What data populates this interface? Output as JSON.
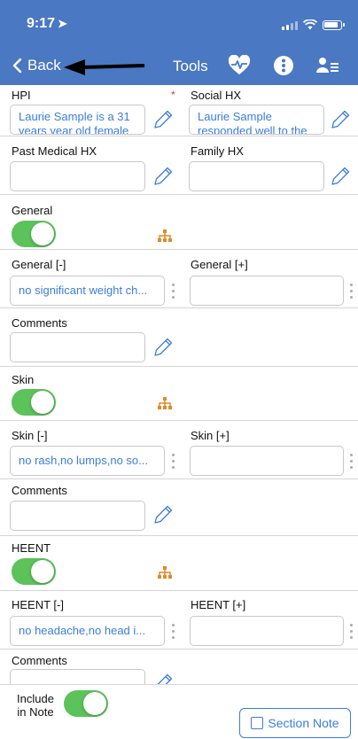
{
  "status": {
    "time": "9:17"
  },
  "nav": {
    "back_label": "Back",
    "tools_label": "Tools"
  },
  "colors": {
    "header": "#4a78c2",
    "accent": "#3b7ddd",
    "toggle_on": "#5cc25a",
    "tree_icon": "#e08a2a",
    "required": "#e0332e"
  },
  "history": {
    "hpi": {
      "label": "HPI",
      "required_mark": "*",
      "value": "Laurie Sample is a 31 years year old female"
    },
    "social": {
      "label": "Social HX",
      "value": "Laurie Sample responded well to the"
    },
    "past_medical": {
      "label": "Past Medical HX",
      "value": ""
    },
    "family": {
      "label": "Family HX",
      "value": ""
    }
  },
  "general": {
    "title": "General",
    "toggle_on": true,
    "neg_label": "General [-]",
    "neg_value": "no significant weight ch...",
    "pos_label": "General [+]",
    "pos_value": "",
    "comments_label": "Comments",
    "comments_value": ""
  },
  "skin": {
    "title": "Skin",
    "toggle_on": true,
    "neg_label": "Skin [-]",
    "neg_value": "no rash,no lumps,no so...",
    "pos_label": "Skin [+]",
    "pos_value": "",
    "comments_label": "Comments",
    "comments_value": ""
  },
  "heent": {
    "title": "HEENT",
    "toggle_on": true,
    "neg_label": "HEENT [-]",
    "neg_value": "no headache,no head i...",
    "pos_label": "HEENT [+]",
    "pos_value": "",
    "comments_label": "Comments",
    "comments_value": ""
  },
  "footer": {
    "include_label": "Include in Note",
    "include_on": true,
    "section_note_label": "Section Note"
  }
}
